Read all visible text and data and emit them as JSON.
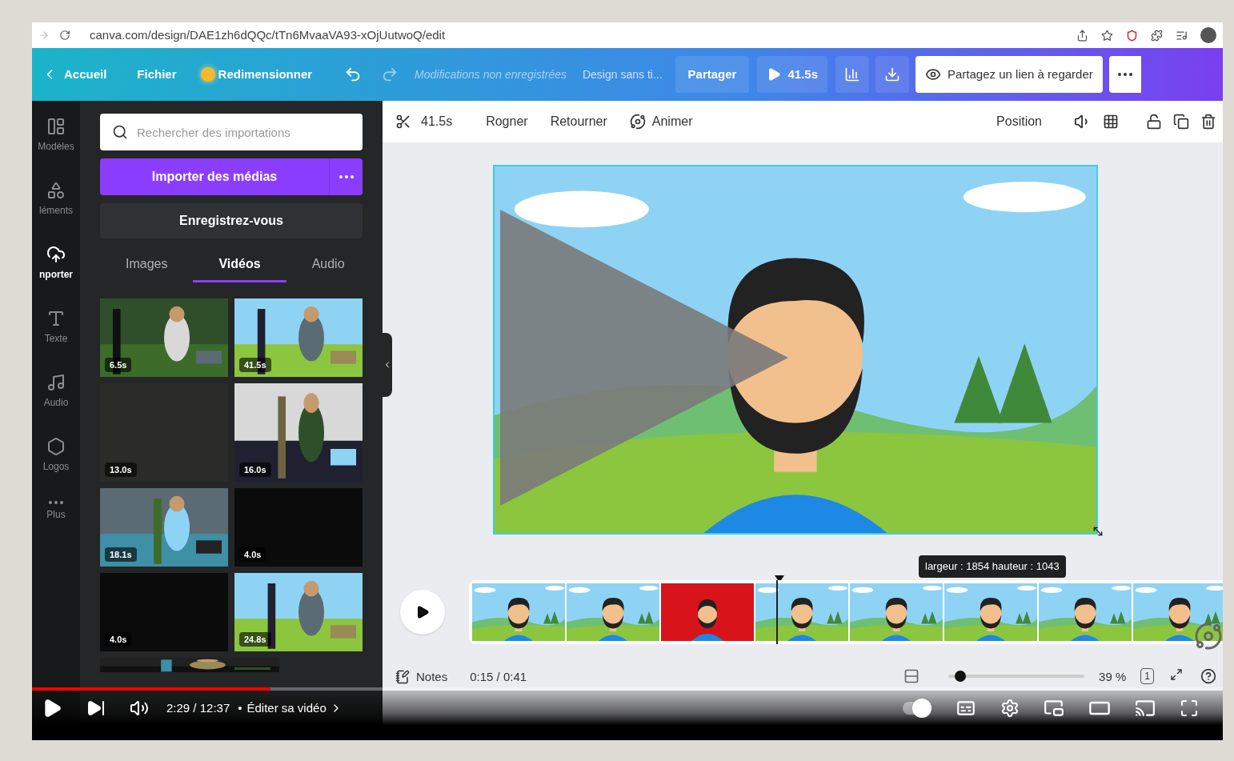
{
  "browser": {
    "url": "canva.com/design/DAE1zh6dQQc/tTn6MvaaVA93-xOjUutwoQ/edit"
  },
  "topbar": {
    "back": "Accueil",
    "file": "Fichier",
    "resize": "Redimensionner",
    "status": "Modifications non enregistrées",
    "design_title": "Design sans ti...",
    "share": "Partager",
    "play_duration": "41.5s",
    "share_link": "Partagez un lien à regarder"
  },
  "rail": [
    {
      "label": "Modèles",
      "selected": false
    },
    {
      "label": "léments",
      "selected": false
    },
    {
      "label": "nporter",
      "selected": true
    },
    {
      "label": "Texte",
      "selected": false
    },
    {
      "label": "Audio",
      "selected": false
    },
    {
      "label": "Logos",
      "selected": false
    },
    {
      "label": "Plus",
      "selected": false
    }
  ],
  "panel": {
    "search": {
      "placeholder": "Rechercher des importations"
    },
    "import_button": "Importer des médias",
    "record_button": "Enregistrez-vous",
    "tabs": [
      {
        "label": "Images",
        "selected": false
      },
      {
        "label": "Vidéos",
        "selected": true
      },
      {
        "label": "Audio",
        "selected": false
      }
    ],
    "thumbnails": [
      {
        "kind": "picture",
        "duration": "6.5s"
      },
      {
        "kind": "picture",
        "duration": "41.5s"
      },
      {
        "kind": "blank",
        "duration": "13.0s"
      },
      {
        "kind": "picture",
        "duration": "16.0s"
      },
      {
        "kind": "picture",
        "duration": "18.1s"
      },
      {
        "kind": "blank",
        "duration": "4.0s"
      },
      {
        "kind": "blank",
        "duration": "4.0s"
      },
      {
        "kind": "picture",
        "duration": "24.8s"
      },
      {
        "kind": "picture"
      }
    ]
  },
  "toolbar": {
    "duration": "41.5s",
    "items": [
      "Rogner",
      "Retourner",
      "Animer"
    ],
    "position": "Position"
  },
  "canvas": {
    "size_tooltip": "largeur : 1854 hauteur : 1043"
  },
  "timeline": {
    "frames": [
      {
        "selected": false
      },
      {
        "selected": false
      },
      {
        "selected": true
      },
      {
        "selected": false
      },
      {
        "selected": false
      },
      {
        "selected": false
      },
      {
        "selected": false
      },
      {
        "selected": false
      }
    ]
  },
  "footer": {
    "notes": "Notes",
    "time": "0:15 / 0:41",
    "zoom_slider": {
      "level": 0.05
    },
    "zoom": "39 %",
    "page_count": "1"
  },
  "player": {
    "progress": {
      "level": 0.2
    },
    "time": "2:29 / 12:37",
    "separator": "•",
    "chapter": "Éditer sa vidéo",
    "autoplay": {
      "on": true
    }
  }
}
